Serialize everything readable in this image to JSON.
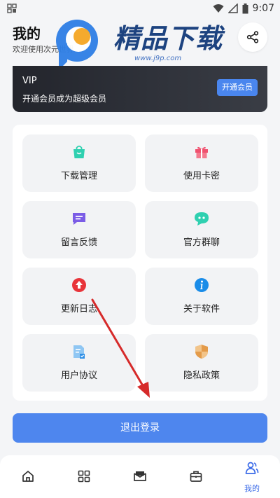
{
  "status_bar": {
    "time": "9:07"
  },
  "header": {
    "title": "我的",
    "subtitle": "欢迎使用次元世界"
  },
  "watermark": {
    "brand": "精品下载",
    "url": "www.j9p.com"
  },
  "vip_card": {
    "title": "VIP",
    "description": "开通会员成为超级会员",
    "button_label": "开通会员"
  },
  "menu": {
    "items": [
      {
        "label": "下载管理",
        "icon": "shopping-bag-icon"
      },
      {
        "label": "使用卡密",
        "icon": "gift-icon"
      },
      {
        "label": "留言反馈",
        "icon": "message-icon"
      },
      {
        "label": "官方群聊",
        "icon": "chat-bubble-icon"
      },
      {
        "label": "更新日志",
        "icon": "update-icon"
      },
      {
        "label": "关于软件",
        "icon": "info-icon"
      },
      {
        "label": "用户协议",
        "icon": "document-icon"
      },
      {
        "label": "隐私政策",
        "icon": "shield-icon"
      }
    ]
  },
  "logout_label": "退出登录",
  "tab_bar": {
    "items": [
      {
        "label": "",
        "icon": "home-icon"
      },
      {
        "label": "",
        "icon": "grid-icon"
      },
      {
        "label": "",
        "icon": "mail-icon"
      },
      {
        "label": "",
        "icon": "briefcase-icon"
      },
      {
        "label": "我的",
        "icon": "user-group-icon",
        "active": true
      }
    ]
  },
  "colors": {
    "accent": "#4e86ee",
    "vip_bg": "#2a2c33",
    "annotation_arrow": "#d62a2a"
  }
}
